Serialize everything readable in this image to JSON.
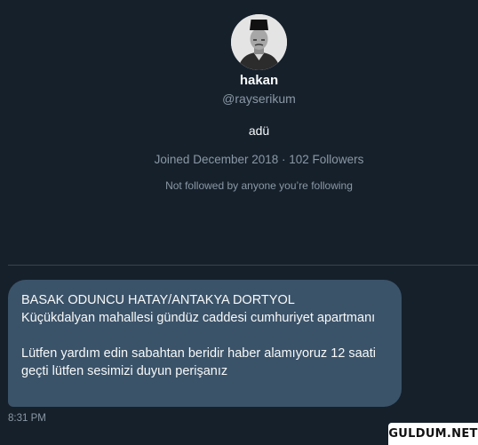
{
  "profile": {
    "display_name": "hakan",
    "handle": "@rayserikum",
    "bio": "adü",
    "joined_text": "Joined December 2018",
    "separator": "·",
    "followers_text": "102 Followers",
    "not_followed_text": "Not followed by anyone you’re following"
  },
  "message": {
    "line1": "BASAK ODUNCU HATAY/ANTAKYA DORTYOL",
    "line2": "Küçükdalyan mahallesi gündüz caddesi cumhuriyet apartmanı",
    "line3": "Lütfen yardım edin sabahtan beridir haber alamıyoruz 12 saati geçti lütfen sesimizi duyun perişanız",
    "timestamp": "8:31 PM"
  },
  "watermark": {
    "text": "GULDUM.NET"
  },
  "colors": {
    "background": "#15202b",
    "bubble": "#3b5369",
    "muted_text": "#8b98a5",
    "divider": "#38444d"
  }
}
